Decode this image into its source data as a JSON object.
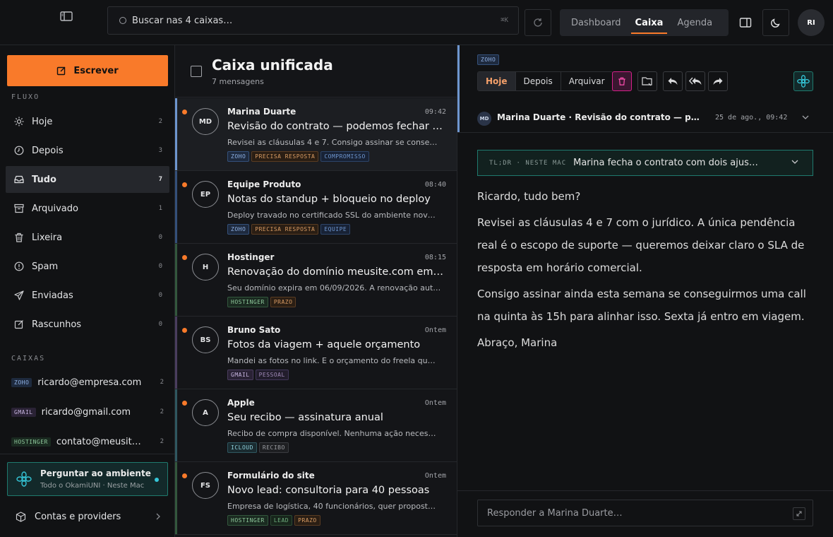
{
  "topbar": {
    "search_placeholder": "Buscar nas 4 caixas…",
    "search_shortcut": "⌘K",
    "tabs": [
      {
        "label": "Dashboard",
        "active": false
      },
      {
        "label": "Caixa",
        "active": true
      },
      {
        "label": "Agenda",
        "active": false
      }
    ],
    "user_initials": "RI"
  },
  "sidebar": {
    "compose_label": "Escrever",
    "flow_label": "FLUXO",
    "items": [
      {
        "label": "Hoje",
        "count": "2",
        "icon": "sun-icon"
      },
      {
        "label": "Depois",
        "count": "3",
        "icon": "clock-icon"
      },
      {
        "label": "Tudo",
        "count": "7",
        "icon": "inbox-icon",
        "active": true
      },
      {
        "label": "Arquivado",
        "count": "1",
        "icon": "archive-icon"
      },
      {
        "label": "Lixeira",
        "count": "0",
        "icon": "trash-icon"
      },
      {
        "label": "Spam",
        "count": "0",
        "icon": "alert-icon"
      },
      {
        "label": "Enviadas",
        "count": "0",
        "icon": "send-icon"
      },
      {
        "label": "Rascunhos",
        "count": "0",
        "icon": "draft-icon"
      }
    ],
    "boxes_label": "CAIXAS",
    "boxes": [
      {
        "tag": "ZOHO",
        "email": "ricardo@empresa.com",
        "count": "2"
      },
      {
        "tag": "GMAIL",
        "email": "ricardo@gmail.com",
        "count": "2"
      },
      {
        "tag": "HOSTINGER",
        "email": "contato@meusit…",
        "count": "2"
      }
    ],
    "ask": {
      "title": "Perguntar ao ambiente",
      "subtitle": "Todo o OkamiUNI · Neste Mac"
    },
    "accounts_label": "Contas e providers"
  },
  "list": {
    "title": "Caixa unificada",
    "subtitle": "7 mensagens",
    "messages": [
      {
        "initials": "MD",
        "from": "Marina Duarte",
        "time": "09:42",
        "subject": "Revisão do contrato — podemos fechar q…",
        "preview": "Revisei as cláusulas 4 e 7. Consigo assinar se conse…",
        "tags": [
          "ZOHO",
          "PRECISA RESPOSTA",
          "COMPROMISSO"
        ],
        "stripe": "#6e96cf"
      },
      {
        "initials": "EP",
        "from": "Equipe Produto",
        "time": "08:40",
        "subject": "Notas do standup + bloqueio no deploy",
        "preview": "Deploy travado no certificado SSL do ambiente nov…",
        "tags": [
          "ZOHO",
          "PRECISA RESPOSTA",
          "EQUIPE"
        ],
        "stripe": "#34507a"
      },
      {
        "initials": "H",
        "from": "Hostinger",
        "time": "08:15",
        "subject": "Renovação do domínio meusite.com em 1…",
        "preview": "Seu domínio expira em 06/09/2026. A renovação aut…",
        "tags": [
          "HOSTINGER",
          "PRAZO"
        ],
        "stripe": "#33573d"
      },
      {
        "initials": "BS",
        "from": "Bruno Sato",
        "time": "Ontem",
        "subject": "Fotos da viagem + aquele orçamento",
        "preview": "Mandei as fotos no link. E o orçamento do freela qu…",
        "tags": [
          "GMAIL",
          "PESSOAL"
        ],
        "stripe": "#4a3d5e"
      },
      {
        "initials": "A",
        "from": "Apple",
        "time": "Ontem",
        "subject": "Seu recibo — assinatura anual",
        "preview": "Recibo de compra disponível. Nenhuma ação neces…",
        "tags": [
          "ICLOUD",
          "RECIBO"
        ],
        "stripe": "#2f5760"
      },
      {
        "initials": "FS",
        "from": "Formulário do site",
        "time": "Ontem",
        "subject": "Novo lead: consultoria para 40 pessoas",
        "preview": "Empresa de logística, 40 funcionários, quer propost…",
        "tags": [
          "HOSTINGER",
          "LEAD",
          "PRAZO"
        ],
        "stripe": "#33573d"
      }
    ]
  },
  "reader": {
    "account_tag": "ZOHO",
    "segments": [
      "Hoje",
      "Depois",
      "Arquivar"
    ],
    "avatar": "MD",
    "thread_title": "Marina Duarte · Revisão do contrato — podemos fechar quinta?",
    "date": "25 de ago., 09:42",
    "tldr_label": "TL;DR · NESTE MAC",
    "tldr_text": "Marina fecha o contrato com dois ajustes…",
    "body": [
      "Ricardo, tudo bem?",
      "Revisei as cláusulas 4 e 7 com o jurídico. A única pendência real é o escopo de suporte — queremos deixar claro o SLA de resposta em horário comercial.",
      "Consigo assinar ainda esta semana se conseguirmos uma call na quinta às 15h para alinhar isso. Sexta já entro em viagem.",
      "Abraço, Marina"
    ],
    "reply_placeholder": "Responder a Marina Duarte…"
  }
}
